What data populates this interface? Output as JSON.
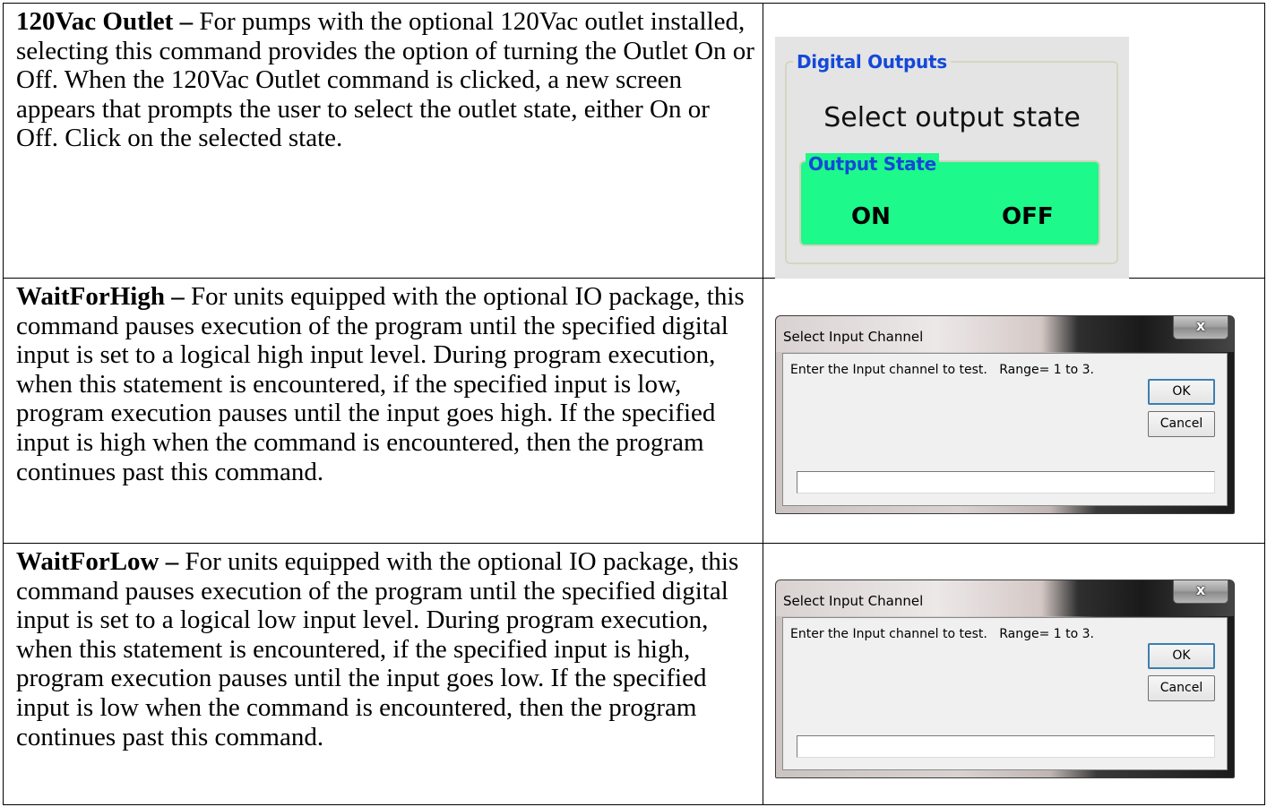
{
  "rows": [
    {
      "term": "120Vac Outlet –",
      "description": " For pumps with the optional 120Vac outlet installed, selecting this command provides the option of turning the Outlet On or Off.   When the 120Vac Outlet command is clicked, a new screen appears that prompts the user to select the outlet state, either On or Off.   Click on the selected state.",
      "panel": {
        "group_title": "Digital Outputs",
        "prompt": "Select output state",
        "state_group_title": "Output State",
        "on_label": "ON",
        "off_label": "OFF",
        "state_group_color": "#1df98a",
        "legend_color": "#1448d8"
      }
    },
    {
      "term": "WaitForHigh –",
      "description": " For units equipped with the optional IO package, this command pauses execution of the program until the specified digital input is set to a logical high input level. During program execution, when this statement is encountered, if the specified input is low, program execution pauses until the input goes high.   If the specified input is high when the command is encountered, then the program continues past this command.",
      "dialog": {
        "title": "Select Input Channel",
        "close_glyph": "x",
        "prompt": "Enter the Input channel to test.   Range= 1 to 3.",
        "ok_label": "OK",
        "cancel_label": "Cancel",
        "input_value": ""
      }
    },
    {
      "term": "WaitForLow –",
      "description": " For units equipped with the optional IO package, this command pauses execution of the program until the specified digital input is set to a logical low input level. During program execution, when this statement is encountered, if the specified input is high, program execution pauses until the input goes low.   If the specified input is low when the command is encountered, then the program continues past this command.",
      "dialog": {
        "title": "Select Input Channel",
        "close_glyph": "x",
        "prompt": "Enter the Input channel to test.   Range= 1 to 3.",
        "ok_label": "OK",
        "cancel_label": "Cancel",
        "input_value": ""
      }
    }
  ]
}
